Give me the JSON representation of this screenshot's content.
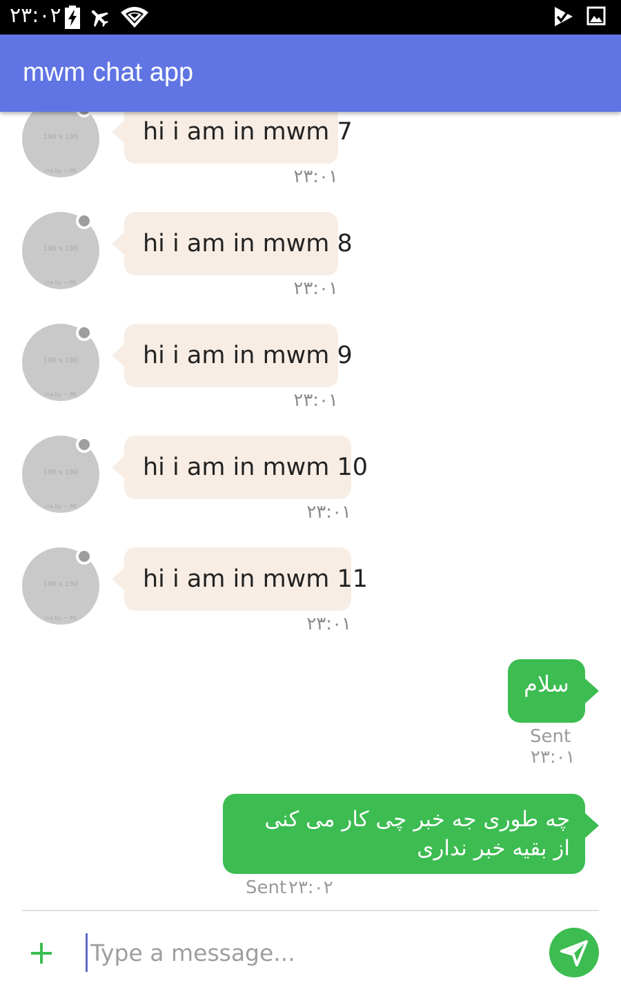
{
  "status_bar": {
    "time": "۲۳:۰۲",
    "icons": [
      "battery-charging-icon",
      "airplane-mode-icon",
      "wifi-icon",
      "notification-check-icon",
      "gallery-icon"
    ]
  },
  "app_bar": {
    "title": "mwm chat app"
  },
  "avatar": {
    "placeholder_label": "190 x 190",
    "credit_text": "rra by ~ MI"
  },
  "incoming_messages": [
    {
      "text": "hi i am in mwm 7",
      "time": "۲۳:۰۱"
    },
    {
      "text": "hi i am in mwm 8",
      "time": "۲۳:۰۱"
    },
    {
      "text": "hi i am in mwm 9",
      "time": "۲۳:۰۱"
    },
    {
      "text": "hi i am in mwm 10",
      "time": "۲۳:۰۱"
    },
    {
      "text": "hi i am in mwm 11",
      "time": "۲۳:۰۱"
    }
  ],
  "outgoing_messages": [
    {
      "lines": [
        "سلام"
      ],
      "status": "Sent",
      "time": "۲۳:۰۱"
    },
    {
      "lines": [
        "چه طوری جه خبر چی کار می کنی",
        "از بقیه خبر نداری"
      ],
      "status": "Sent",
      "time": "۲۳:۰۲"
    }
  ],
  "composer": {
    "placeholder": "Type a message...",
    "value": "",
    "add_icon": "plus-icon",
    "send_icon": "send-icon"
  },
  "colors": {
    "app_bar": "#6075e3",
    "incoming_bubble": "#f8ede4",
    "outgoing_bubble": "#3cbc51",
    "send_button": "#3cbc51",
    "add_icon": "#3cbc51",
    "presence_dot": "#9e9e9e"
  }
}
